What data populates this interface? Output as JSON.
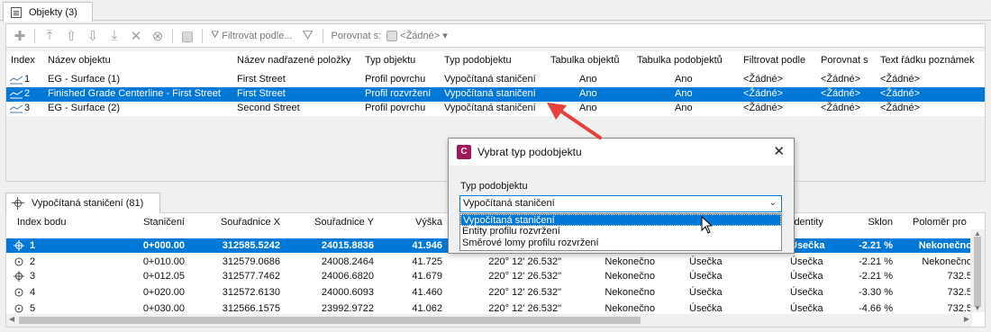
{
  "top_tab": {
    "label": "Objekty (3)"
  },
  "toolbar": {
    "filter_label": "Filtrovat podle...",
    "compare_label": "Porovnat s:",
    "compare_value": "<Žádné>"
  },
  "objects_table": {
    "headers": [
      "Index",
      "Název objektu",
      "Název nadřazené položky",
      "Typ objektu",
      "Typ podobjektu",
      "Tabulka objektů",
      "Tabulka podobjektů",
      "Filtrovat podle",
      "Porovnat s",
      "Text řádku poznámek"
    ],
    "rows": [
      [
        "1",
        "EG - Surface (1)",
        "First Street",
        "Profil povrchu",
        "Vypočítaná staničení",
        "Ano",
        "Ano",
        "<Žádné>",
        "<Žádné>",
        "<Žádné>"
      ],
      [
        "2",
        "Finished Grade Centerline - First Street",
        "First Street",
        "Profil rozvržení",
        "Vypočítaná staničení",
        "Ano",
        "Ano",
        "<Žádné>",
        "<Žádné>",
        "<Žádné>"
      ],
      [
        "3",
        "EG - Surface (2)",
        "Second Street",
        "Profil povrchu",
        "Vypočítaná staničení",
        "Ano",
        "Ano",
        "<Žádné>",
        "<Žádné>",
        "<Žádné>"
      ]
    ]
  },
  "bottom_tab": {
    "label": "Vypočítaná staničení (81)"
  },
  "points_table": {
    "headers": [
      "Index bodu",
      "Staničení",
      "Souřadnice X",
      "Souřadnice Y",
      "Výška",
      "",
      "",
      "",
      "identity",
      "Sklon",
      "Poloměr pro"
    ],
    "rows": [
      [
        "1",
        "0+000.00",
        "312585.5242",
        "24015.8836",
        "41.946",
        "",
        "",
        "",
        "Úsečka",
        "-2.21 %",
        "Nekonečno"
      ],
      [
        "2",
        "0+010.00",
        "312579.0686",
        "24008.2464",
        "41.725",
        "220° 12' 26.532\"",
        "Nekonečno",
        "Úsečka",
        "Úsečka",
        "-2.21 %",
        "Nekonečno"
      ],
      [
        "3",
        "0+012.05",
        "312577.7462",
        "24006.6820",
        "41.679",
        "220° 12' 26.532\"",
        "Nekonečno",
        "Úsečka",
        "Úsečka",
        "-2.21 %",
        "732.5"
      ],
      [
        "4",
        "0+020.00",
        "312572.6130",
        "24000.6093",
        "41.460",
        "220° 12' 26.532\"",
        "Nekonečno",
        "Úsečka",
        "Úsečka",
        "-3.30 %",
        "732.5"
      ],
      [
        "5",
        "0+030.00",
        "312566.1575",
        "23992.9722",
        "41.062",
        "220° 12' 26.532\"",
        "Nekonečno",
        "Úsečka",
        "Úsečka",
        "-4.66 %",
        "732.5"
      ]
    ]
  },
  "dialog": {
    "app_icon": "C",
    "title": "Vybrat typ podobjektu",
    "field_label": "Typ podobjektu",
    "selected": "Vypočítaná staničení",
    "options": [
      "Vypočítaná staničení",
      "Entity profilu rozvržení",
      "Směrové lomy profilu rozvržení"
    ]
  },
  "colors": {
    "selection": "#0078d7",
    "arrow": "#e8403c",
    "app_icon": "#a2165b"
  }
}
